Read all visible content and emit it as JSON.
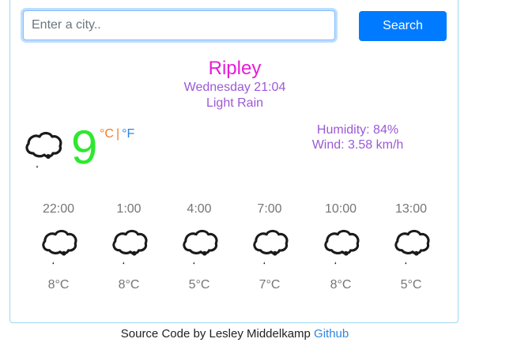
{
  "search": {
    "placeholder": "Enter a city..",
    "value": "",
    "button_label": "Search"
  },
  "current": {
    "city": "Ripley",
    "datetime": "Wednesday 21:04",
    "description": "Light Rain",
    "icon": "light-rain-cloud-icon",
    "temperature": "9",
    "unit_celsius": "°C",
    "unit_separator": "|",
    "unit_fahrenheit": "°F",
    "humidity": "Humidity: 84%",
    "wind": "Wind: 3.58 km/h"
  },
  "forecast": [
    {
      "time": "22:00",
      "temp": "8°C",
      "icon": "light-rain-cloud-icon"
    },
    {
      "time": "1:00",
      "temp": "8°C",
      "icon": "light-rain-cloud-icon"
    },
    {
      "time": "4:00",
      "temp": "5°C",
      "icon": "light-rain-cloud-icon"
    },
    {
      "time": "7:00",
      "temp": "7°C",
      "icon": "light-rain-cloud-icon"
    },
    {
      "time": "10:00",
      "temp": "8°C",
      "icon": "light-rain-cloud-icon"
    },
    {
      "time": "13:00",
      "temp": "5°C",
      "icon": "light-rain-cloud-icon"
    }
  ],
  "footer": {
    "text": "Source Code by Lesley Middelkamp",
    "link_label": "Github"
  },
  "colors": {
    "city": "#e61bd8",
    "secondary_text": "#9b59d6",
    "temperature": "#2ee82e",
    "celsius": "#ee7d2b",
    "fahrenheit": "#2e86de",
    "button": "#007bff",
    "card_border": "#9fd6ef"
  }
}
